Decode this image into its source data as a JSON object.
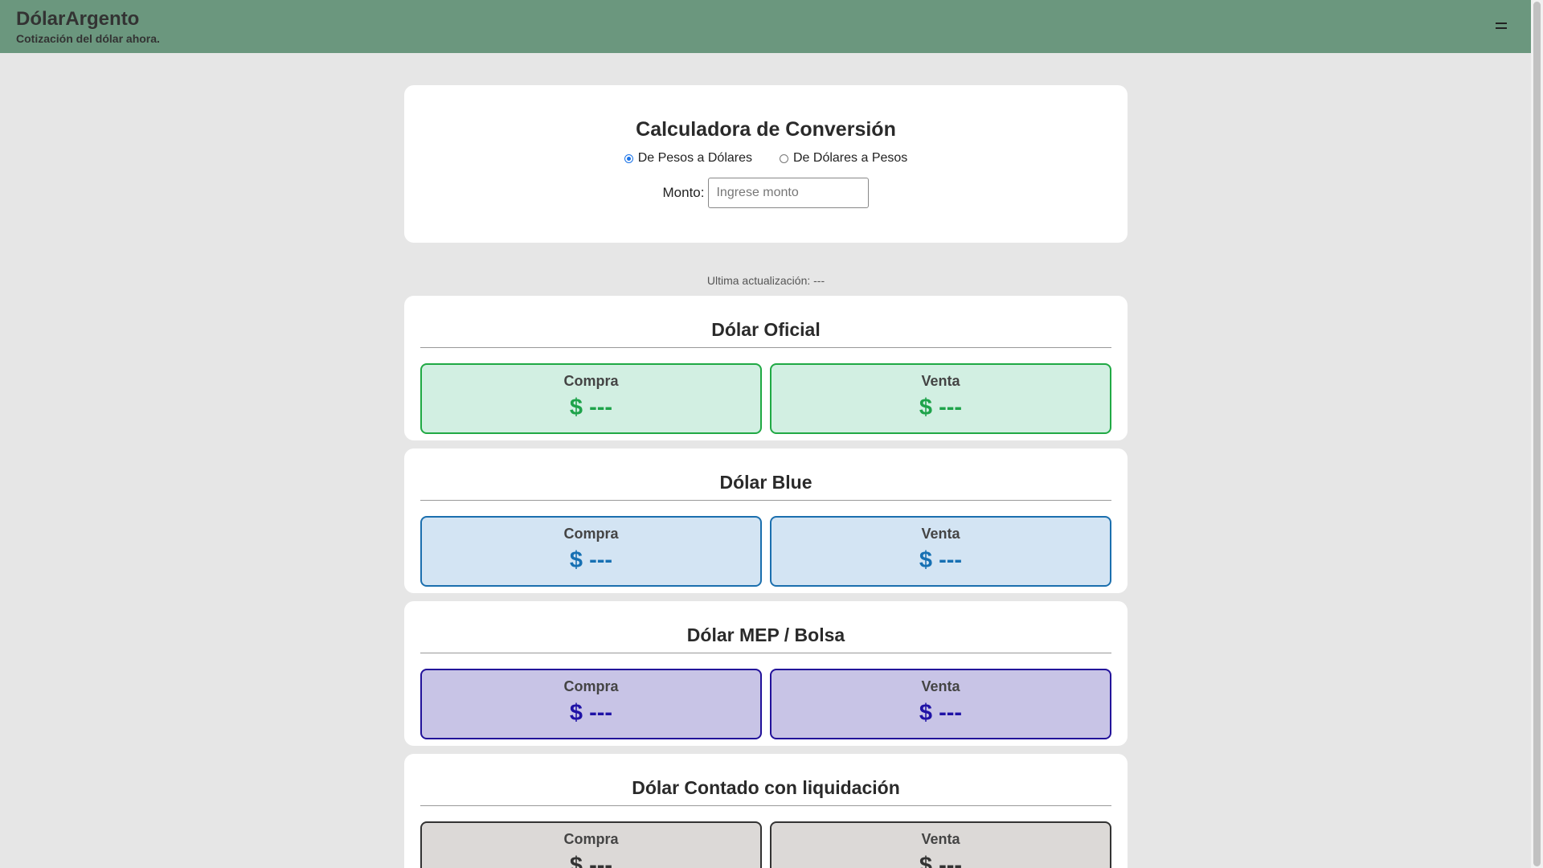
{
  "header": {
    "title": "DólarArgento",
    "subtitle": "Cotización del dólar ahora.",
    "menu_icon": "hamburger-menu-icon"
  },
  "calculator": {
    "title": "Calculadora de Conversión",
    "options": [
      {
        "label": "De Pesos a Dólares",
        "selected": true
      },
      {
        "label": "De Dólares a Pesos",
        "selected": false
      }
    ],
    "amount_label": "Monto:",
    "amount_value": "",
    "amount_placeholder": "Ingrese monto"
  },
  "last_update": "Ultima actualización: ---",
  "rates": [
    {
      "title": "Dólar Oficial",
      "buy_label": "Compra",
      "buy_value": "$ ---",
      "sell_label": "Venta",
      "sell_value": "$ ---",
      "accent": "#1ea34a"
    },
    {
      "title": "Dólar Blue",
      "buy_label": "Compra",
      "buy_value": "$ ---",
      "sell_label": "Venta",
      "sell_value": "$ ---",
      "accent": "#1670b3"
    },
    {
      "title": "Dólar MEP / Bolsa",
      "buy_label": "Compra",
      "buy_value": "$ ---",
      "sell_label": "Venta",
      "sell_value": "$ ---",
      "accent": "#1f12a6"
    },
    {
      "title": "Dólar Contado con liquidación",
      "buy_label": "Compra",
      "buy_value": "$ ---",
      "sell_label": "Venta",
      "sell_value": "$ ---",
      "accent": "#333333"
    }
  ],
  "colors": {
    "header_bg": "#6b977e",
    "page_bg": "#e6e6e6"
  }
}
